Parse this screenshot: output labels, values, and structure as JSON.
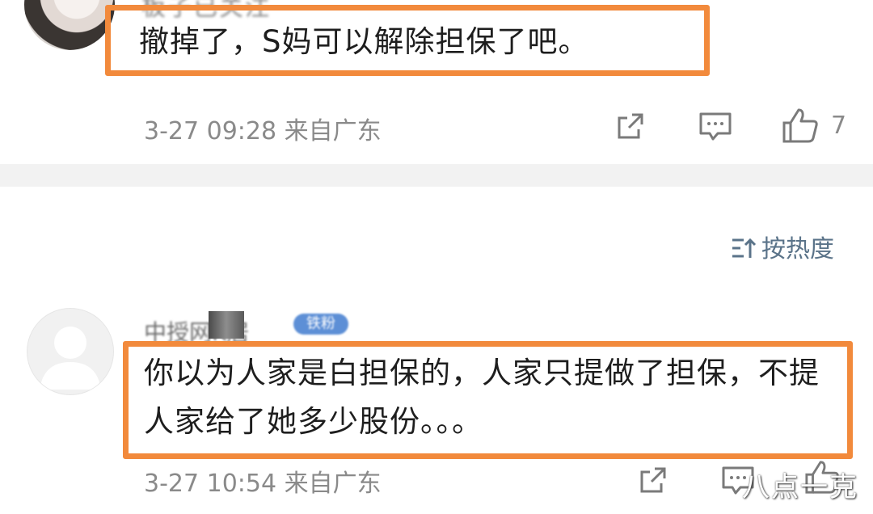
{
  "comments": [
    {
      "username": "板子已关注",
      "text": "撤掉了，S妈可以解除担保了吧。",
      "time": "3-27 09:28",
      "location": "来自广东",
      "like_count": "7",
      "highlight_color": "#f28a3c"
    },
    {
      "username": "中授网K居",
      "badge": "铁粉",
      "text": "你以为人家是白担保的，人家只提做了担保，不提人家给了她多少股份。。。",
      "time": "3-27 10:54",
      "location": "来自广东",
      "highlight_color": "#f28a3c"
    }
  ],
  "sort": {
    "label": "按热度"
  },
  "watermark": "八点一克",
  "icons": [
    "share-icon",
    "comment-icon",
    "like-icon",
    "sort-icon"
  ],
  "colors": {
    "highlight": "#f28a3c",
    "meta": "#8a8a8a",
    "sort": "#5a7389",
    "badge": "#5d8fd6"
  }
}
